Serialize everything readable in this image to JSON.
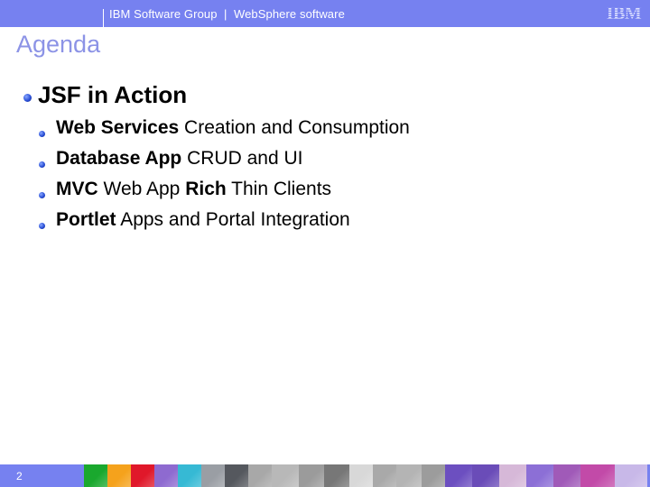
{
  "header": {
    "group": "IBM Software Group",
    "separator": "|",
    "product": "WebSphere software",
    "logo_text": "IBM",
    "bar_color": "#7681f0"
  },
  "title": "Agenda",
  "content": {
    "level1": "JSF in Action",
    "items": [
      {
        "bold": "Web Services",
        "rest": " Creation and Consumption"
      },
      {
        "bold": "Database App",
        "rest": " CRUD and UI"
      },
      {
        "bold1": "MVC",
        "mid": " Web App ",
        "bold2": "Rich",
        "rest": " Thin Clients"
      },
      {
        "bold": "Portlet",
        "rest": " Apps and Portal Integration"
      }
    ]
  },
  "footer": {
    "page_number": "2",
    "strip_tiles": [
      {
        "name": "green-checker-tile",
        "color": "#1aa82e"
      },
      {
        "name": "orange-sun-tile",
        "color": "#f5a21c"
      },
      {
        "name": "red-starburst-tile",
        "color": "#e0182a"
      },
      {
        "name": "purple-fiber-tile",
        "color": "#8e6ad0"
      },
      {
        "name": "cyan-crystal-tile",
        "color": "#36b9d4"
      },
      {
        "name": "gray-metal-tile",
        "color": "#9a9ea4"
      },
      {
        "name": "dark-swirl-tile",
        "color": "#55585e"
      },
      {
        "name": "face-bw-tile",
        "color": "#a8a8a8"
      },
      {
        "name": "gray-wave-tile",
        "color": "#b8b8b8"
      },
      {
        "name": "gray-plain-tile",
        "color": "#9b9b9b"
      },
      {
        "name": "hand-bw-tile",
        "color": "#777777"
      },
      {
        "name": "light-gray-tile",
        "color": "#d8d8d8"
      },
      {
        "name": "mid-gray-tile",
        "color": "#a9a9a9"
      },
      {
        "name": "gray-curve-tile",
        "color": "#b4b4b4"
      },
      {
        "name": "gray-tile",
        "color": "#9c9c9c"
      },
      {
        "name": "purple-starburst-tile",
        "color": "#6c4fc0"
      },
      {
        "name": "purple-checker-tile",
        "color": "#6a4cb8"
      },
      {
        "name": "face-pink-tile",
        "color": "#d6b8d8"
      },
      {
        "name": "purple-globe-tile",
        "color": "#8c6fd6"
      },
      {
        "name": "violet-tile",
        "color": "#a05ab8"
      },
      {
        "name": "magenta-cross-tile",
        "color": "#c24aa8"
      },
      {
        "name": "lavender-tile",
        "color": "#c8b8e8"
      }
    ]
  }
}
